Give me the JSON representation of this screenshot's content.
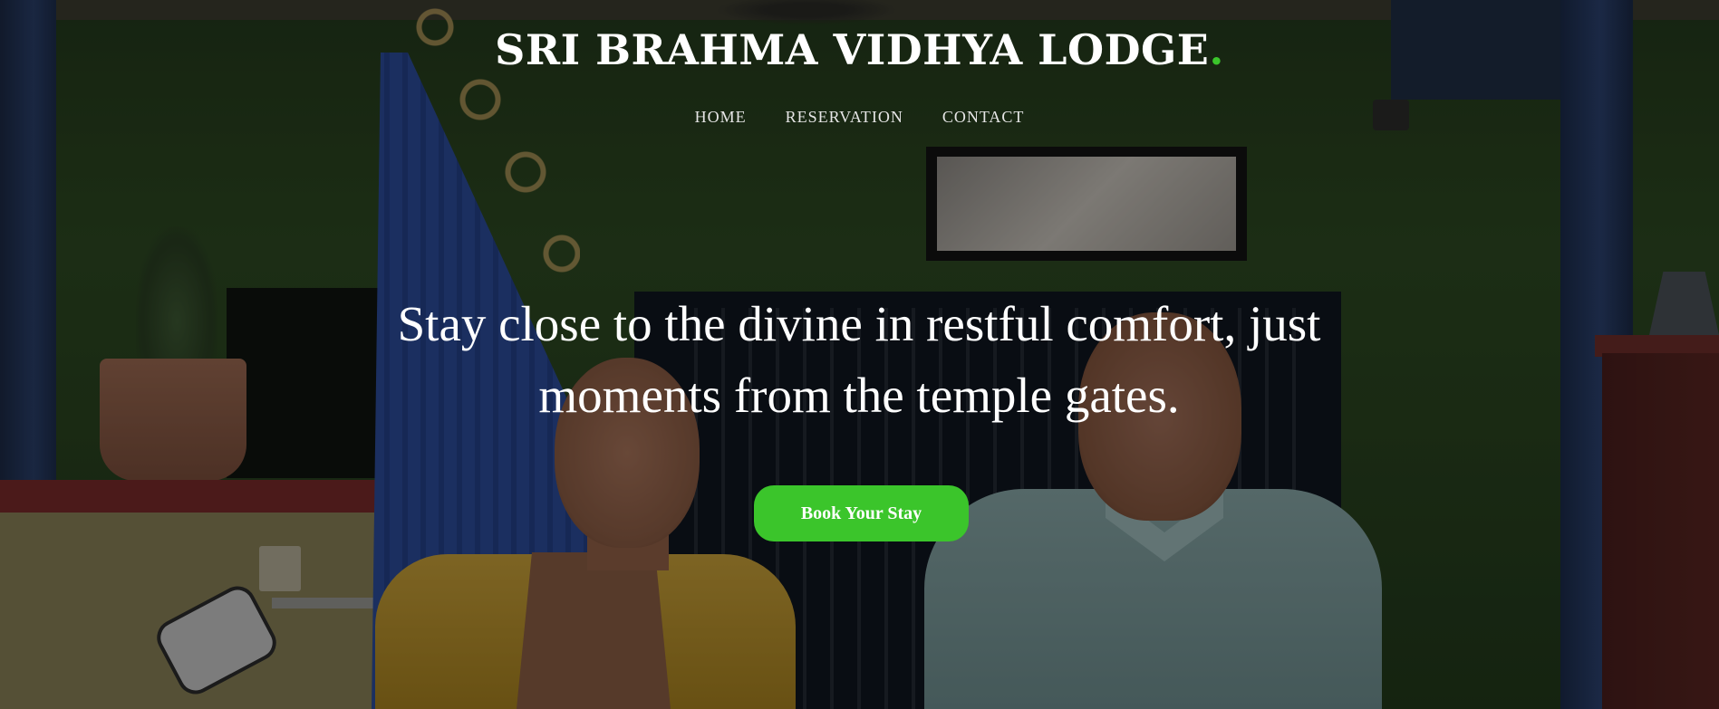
{
  "brand": {
    "name": "SRI BRAHMA VIDHYA LODGE",
    "dot": ".",
    "accent_color": "#3bc52b"
  },
  "nav": {
    "items": [
      {
        "label": "HOME"
      },
      {
        "label": "RESERVATION"
      },
      {
        "label": "CONTACT"
      }
    ]
  },
  "hero": {
    "tagline": "Stay close to the divine in restful comfort, just moments from the temple gates.",
    "cta_label": "Book Your Stay",
    "cta_color": "#3bc52b"
  }
}
